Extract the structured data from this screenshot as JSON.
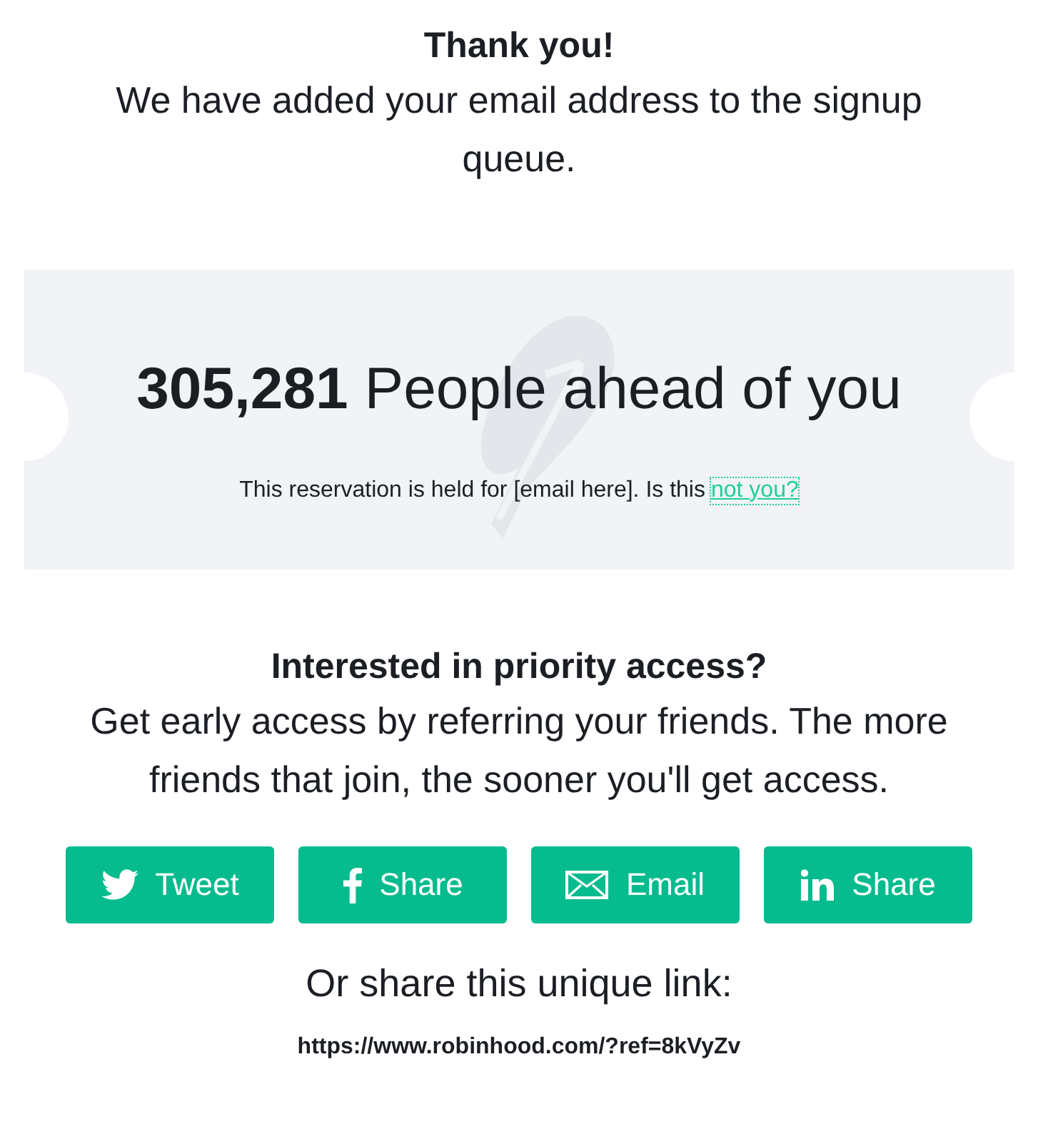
{
  "confirmation": {
    "title": "Thank you!",
    "message": "We have added your email address to the signup queue."
  },
  "queue_card": {
    "heading": "**305,281** People ahead of you",
    "reservation_text": "This reservation is held for [email here]. Is this",
    "link": "not you?"
  },
  "referral": {
    "title": "Interested in priority access?",
    "message": "Get early access by referring your friends. The more friends that join, the sooner you'll get access."
  },
  "share_buttons": [
    {
      "kind": "twitter",
      "label": "Tweet"
    },
    {
      "kind": "facebook",
      "label": "Share"
    },
    {
      "kind": "email",
      "label": "Email"
    },
    {
      "kind": "linkedin",
      "label": "Share"
    }
  ],
  "unique_link": {
    "label": "Or share this unique link:",
    "url": "https://www.robinhood.com/?ref=8kVyZv"
  }
}
